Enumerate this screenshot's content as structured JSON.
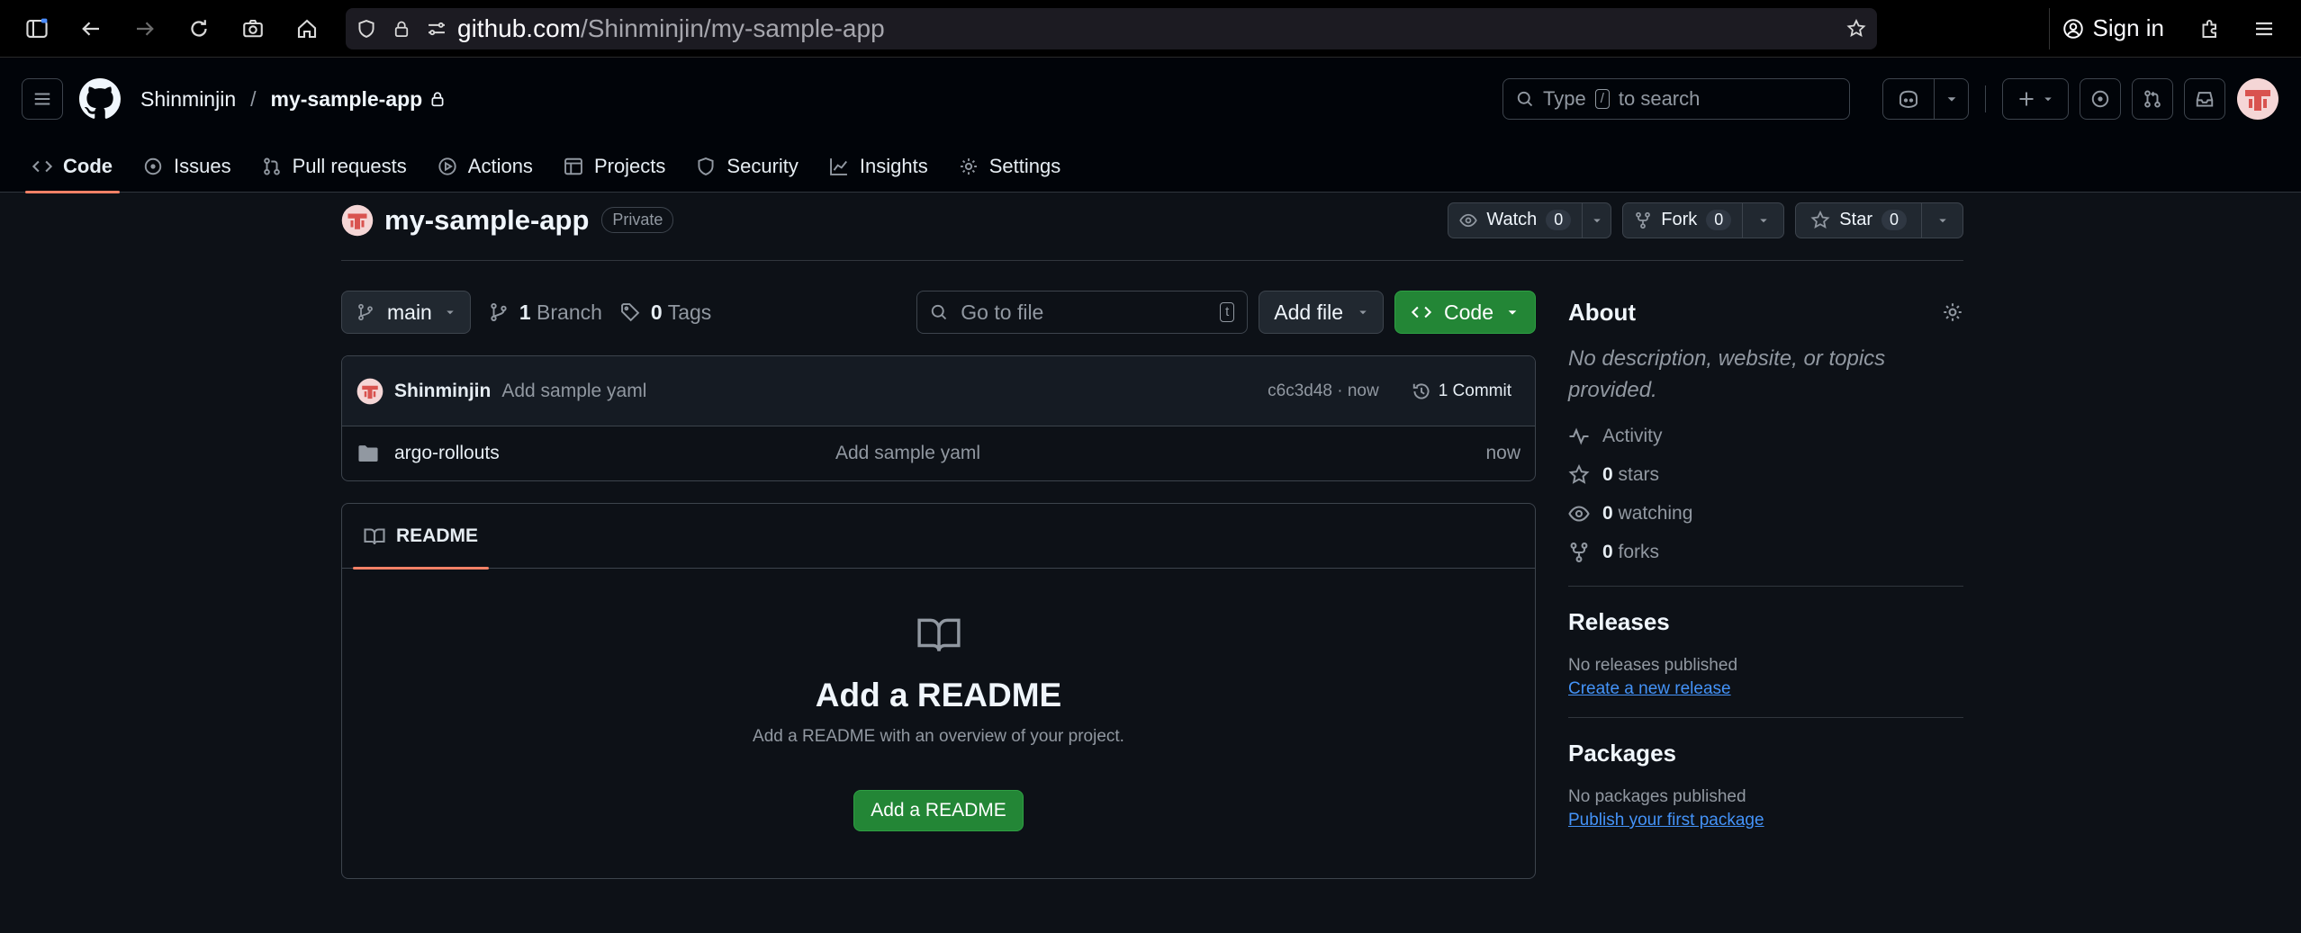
{
  "browser": {
    "url_host": "github.com",
    "url_path": "/Shinminjin/my-sample-app",
    "sign_in_label": "Sign in"
  },
  "header": {
    "owner": "Shinminjin",
    "slash": "/",
    "repo": "my-sample-app",
    "search_placeholder_pre": "Type",
    "search_key": "/",
    "search_placeholder_post": "to search"
  },
  "tabs": [
    {
      "label": "Code",
      "icon": "code-icon"
    },
    {
      "label": "Issues",
      "icon": "issue-opened-icon"
    },
    {
      "label": "Pull requests",
      "icon": "git-pull-request-icon"
    },
    {
      "label": "Actions",
      "icon": "play-icon"
    },
    {
      "label": "Projects",
      "icon": "table-icon"
    },
    {
      "label": "Security",
      "icon": "shield-icon"
    },
    {
      "label": "Insights",
      "icon": "graph-icon"
    },
    {
      "label": "Settings",
      "icon": "gear-icon"
    }
  ],
  "repo": {
    "name": "my-sample-app",
    "visibility": "Private",
    "watch_label": "Watch",
    "watch_count": "0",
    "fork_label": "Fork",
    "fork_count": "0",
    "star_label": "Star",
    "star_count": "0"
  },
  "toolbar": {
    "branch": "main",
    "branch_count": "1",
    "branch_label": "Branch",
    "tag_count": "0",
    "tag_label": "Tags",
    "goto_placeholder": "Go to file",
    "goto_key": "t",
    "add_file_label": "Add file",
    "code_label": "Code"
  },
  "commit": {
    "author": "Shinminjin",
    "message": "Add sample yaml",
    "sha_time": "c6c3d48 · now",
    "commits_label": "1 Commit"
  },
  "files": [
    {
      "name": "argo-rollouts",
      "message": "Add sample yaml",
      "time": "now",
      "icon": "folder-icon"
    }
  ],
  "readme": {
    "tab_label": "README",
    "heading": "Add a README",
    "description": "Add a README with an overview of your project.",
    "button_label": "Add a README"
  },
  "about": {
    "title": "About",
    "description": "No description, website, or topics provided.",
    "activity": "Activity",
    "stars_count": "0",
    "stars_label": "stars",
    "watching_count": "0",
    "watching_label": "watching",
    "forks_count": "0",
    "forks_label": "forks"
  },
  "releases": {
    "title": "Releases",
    "empty": "No releases published",
    "link": "Create a new release"
  },
  "packages": {
    "title": "Packages",
    "empty": "No packages published",
    "link": "Publish your first package"
  },
  "colors": {
    "accent_green": "#238636",
    "tab_underline": "#f78166",
    "link": "#4493f8",
    "background": "#0d1117"
  }
}
